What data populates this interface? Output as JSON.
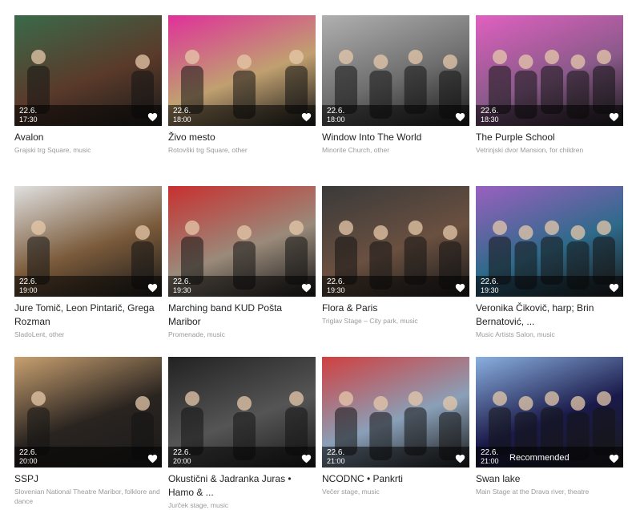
{
  "events": [
    {
      "title": "Avalon",
      "meta": "Grajski trg Square, music",
      "date": "22.6.",
      "time": "17:30",
      "recommended": ""
    },
    {
      "title": "Živo mesto",
      "meta": "Rotovški trg Square, other",
      "date": "22.6.",
      "time": "18:00",
      "recommended": ""
    },
    {
      "title": "Window Into The World",
      "meta": "Minorite Church, other",
      "date": "22.6.",
      "time": "18:00",
      "recommended": ""
    },
    {
      "title": "The Purple School",
      "meta": "Vetrinjski dvor Mansion, for children",
      "date": "22.6.",
      "time": "18:30",
      "recommended": ""
    },
    {
      "title": "Jure Tomič, Leon Pintarič, Grega Rozman",
      "meta": "SladoLent, other",
      "date": "22.6.",
      "time": "19:00",
      "recommended": ""
    },
    {
      "title": "Marching band KUD Pošta Maribor",
      "meta": "Promenade, music",
      "date": "22.6.",
      "time": "19:30",
      "recommended": ""
    },
    {
      "title": "Flora & Paris",
      "meta": "Triglav Stage – City park, music",
      "date": "22.6.",
      "time": "19:30",
      "recommended": ""
    },
    {
      "title": "Veronika Čikovič, harp; Brin Bernatović, ...",
      "meta": "Music Artists Salon, music",
      "date": "22.6.",
      "time": "19:30",
      "recommended": ""
    },
    {
      "title": "SSPJ",
      "meta": "Slovenian National Theatre Maribor, folklore and dance",
      "date": "22.6.",
      "time": "20:00",
      "recommended": ""
    },
    {
      "title": "Okustični & Jadranka Juras • Hamo & ...",
      "meta": "Jurček stage, music",
      "date": "22.6.",
      "time": "20:00",
      "recommended": ""
    },
    {
      "title": "NCODNC • Pankrti",
      "meta": "Večer stage, music",
      "date": "22.6.",
      "time": "21:00",
      "recommended": ""
    },
    {
      "title": "Swan lake",
      "meta": "Main Stage at the Drava river, theatre",
      "date": "22.6.",
      "time": "21:00",
      "recommended": "Recommended"
    }
  ],
  "colors": {
    "thumbs": [
      "#5a3a2a",
      "#c0a070",
      "#6e6e6e",
      "#8a5a8a",
      "#7a5a3a",
      "#9a8a7a",
      "#6a5040",
      "#2e6a8a",
      "#2a2420",
      "#555555",
      "#8aa0b8",
      "#1a1a4a"
    ],
    "accents": [
      "#3a6a4a",
      "#e0309a",
      "#b0b0b0",
      "#e060c0",
      "#e0e0e0",
      "#c83030",
      "#3a3a3a",
      "#9a60c0",
      "#c8a070",
      "#222222",
      "#d04040",
      "#8ab0e0"
    ]
  }
}
